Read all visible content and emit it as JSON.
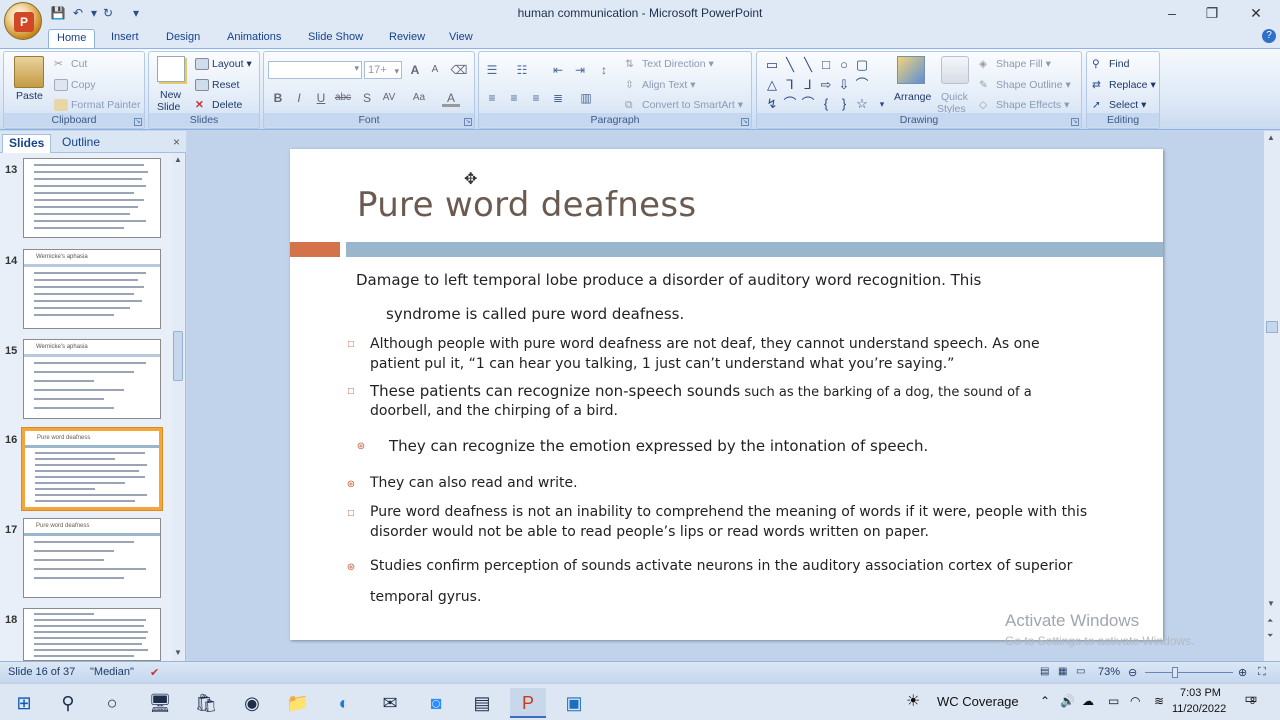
{
  "window": {
    "title": "human communication - Microsoft PowerPoint",
    "controls": [
      "–",
      "❐",
      "✕"
    ]
  },
  "ribbon": {
    "tabs": [
      "Home",
      "Insert",
      "Design",
      "Animations",
      "Slide Show",
      "Review",
      "View"
    ],
    "active_tab": "Home",
    "clipboard": {
      "label": "Clipboard",
      "paste": "Paste",
      "cut": "Cut",
      "copy": "Copy",
      "format_painter": "Format Painter"
    },
    "slides": {
      "label": "Slides",
      "new_slide_1": "New",
      "new_slide_2": "Slide",
      "layout": "Layout",
      "reset": "Reset",
      "delete": "Delete"
    },
    "font": {
      "label": "Font",
      "font_name": "",
      "font_size": "17+"
    },
    "paragraph": {
      "label": "Paragraph",
      "text_direction": "Text Direction",
      "align_text": "Align Text",
      "convert_smartart": "Convert to SmartArt"
    },
    "drawing": {
      "label": "Drawing",
      "arrange": "Arrange",
      "quick_styles_1": "Quick",
      "quick_styles_2": "Styles",
      "shape_fill": "Shape Fill",
      "shape_outline": "Shape Outline",
      "shape_effects": "Shape Effects"
    },
    "editing": {
      "label": "Editing",
      "find": "Find",
      "replace": "Replace",
      "select": "Select"
    }
  },
  "pane": {
    "tabs": [
      "Slides",
      "Outline"
    ],
    "close": "×",
    "thumbnails": [
      {
        "num": "13",
        "title": ""
      },
      {
        "num": "14",
        "title": "Wernicke's aphasia"
      },
      {
        "num": "15",
        "title": "Wernicke's aphasia"
      },
      {
        "num": "16",
        "title": "Pure word deafness",
        "selected": true
      },
      {
        "num": "17",
        "title": "Pure word deafness"
      },
      {
        "num": "18",
        "title": ""
      }
    ]
  },
  "slide": {
    "title": "Pure word deafness",
    "intro_line1": "Damage to left temporal lobe produce a disorder of auditory word recognition. This",
    "intro_line2": "syndrome is called pure word deafness.",
    "b1_line1": "Although people with pure word deafness are not deaf, they cannot understand speech. As one",
    "b1_line2": "patient pul it, “1 can hear you talking, 1 just can’t understand what you’re saying.”",
    "b2_bold": "These patients can recognize non-speech sounds",
    "b2_rest": " such as the barking of a dog, the sound of a",
    "b2_line2": "doorbell, and the chirping of a bird.",
    "b3": "They can recognize the emotion expressed by the intonation of speech.",
    "b4": "They can also read and write.",
    "b5_line1": "Pure word deafness is not an inability to comprehend the meaning of words if it were, people with this",
    "b5_line2": "disorder would not be able to read people’s lips or read words written on paper.",
    "b6_line1": "Studies confirm perception of sounds activate neurons in the auditory association cortex of superior",
    "b6_line2": "temporal gyrus."
  },
  "watermark": {
    "line1": "Activate Windows",
    "line2": "Go to Settings to activate Windows."
  },
  "status": {
    "slide_info": "Slide 16 of 37",
    "theme": "\"Median\"",
    "zoom": "73%"
  },
  "taskbar": {
    "weather": "WC Coverage",
    "time": "7:03 PM",
    "date": "11/20/2022",
    "notifications": "8"
  }
}
